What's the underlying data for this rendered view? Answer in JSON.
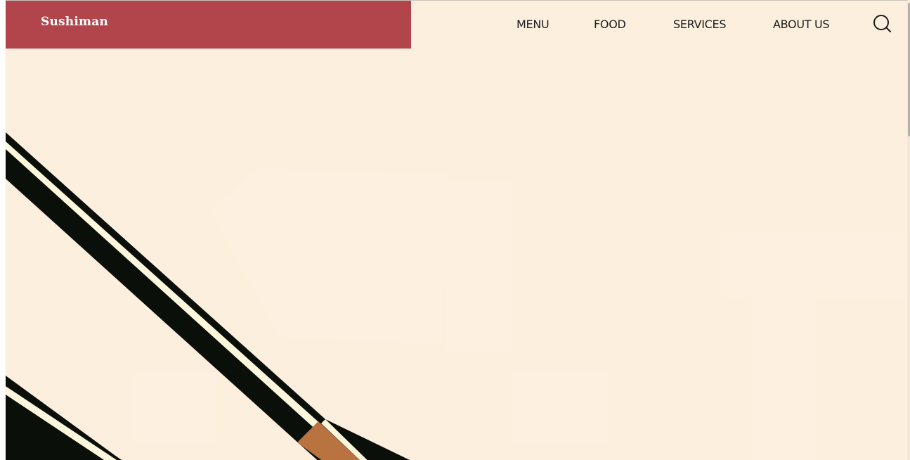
{
  "brand": {
    "name": "Sushiman"
  },
  "nav": {
    "items": [
      {
        "label": "MENU"
      },
      {
        "label": "FOOD"
      },
      {
        "label": "SERVICES"
      },
      {
        "label": "ABOUT US"
      }
    ],
    "search_icon": "search-icon"
  },
  "colors": {
    "brand_bar": "#b1454b",
    "background": "#fdefde",
    "chopstick_dark": "#0b0f0a",
    "chopstick_stripe": "#fcf7dc",
    "chopstick_tip": "#b87340"
  }
}
